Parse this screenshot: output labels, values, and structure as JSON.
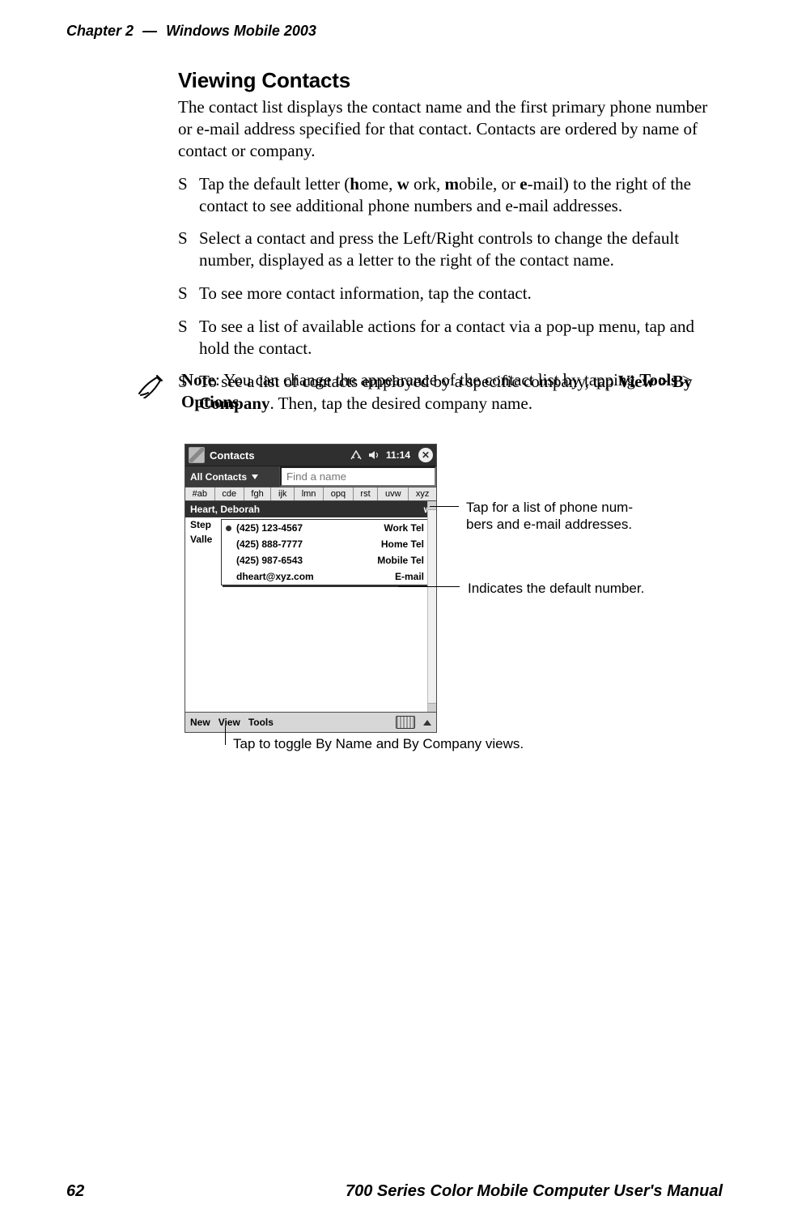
{
  "header": {
    "chapter": "Chapter 2",
    "sep": "—",
    "book_part": "Windows Mobile 2003"
  },
  "footer": {
    "page": "62",
    "manual": "700 Series Color Mobile Computer User's Manual"
  },
  "section": {
    "title": "Viewing Contacts",
    "intro": "The contact list displays the contact name and the first primary phone number or e-mail address specified for that contact. Contacts are ordered by name of contact or company."
  },
  "bullets": {
    "b1_pre": "Tap the default letter (",
    "b1_h": "h",
    "b1_home_rest": "ome, ",
    "b1_w": "w",
    "b1_work_rest": " ork, ",
    "b1_m": "m",
    "b1_mobile_rest": "obile, or ",
    "b1_e": "e",
    "b1_email_rest": "-mail) to the right of the contact to see additional phone numbers and e-mail addresses.",
    "b2": "Select a contact and press the Left/Right controls to change the default number, displayed as a letter to the right of the contact name.",
    "b3": "To see more contact information, tap the contact.",
    "b4": "To see a list of available actions for a contact via a pop-up menu, tap and hold the contact.",
    "b5_pre": "To see a list of contacts employed by a specific company, tap ",
    "b5_view": "View",
    "b5_gt": " > ",
    "b5_bycompany": "By Company",
    "b5_post": ". Then, tap the desired company name."
  },
  "note": {
    "label": "Note",
    "pre": ": You can change the appearance of the contact list by tapping ",
    "tools": "Tools",
    "gt": " > ",
    "options": "Options",
    "post": "."
  },
  "shot": {
    "title": "Contacts",
    "clock": "11:14",
    "filter": "All Contacts",
    "find": "Find a name",
    "alpha": [
      "#ab",
      "cde",
      "fgh",
      "ijk",
      "lmn",
      "opq",
      "rst",
      "uvw",
      "xyz"
    ],
    "sel_name": "Heart, Deborah",
    "sel_def": "w",
    "stub1": "Step",
    "stub2": "Valle",
    "popup": [
      {
        "v": "(425) 123-4567",
        "t": "Work Tel"
      },
      {
        "v": "(425) 888-7777",
        "t": "Home Tel"
      },
      {
        "v": "(425) 987-6543",
        "t": "Mobile Tel"
      },
      {
        "v": "dheart@xyz.com",
        "t": "E-mail"
      }
    ],
    "menu": [
      "New",
      "View",
      "Tools"
    ]
  },
  "callouts": {
    "c1a": "Tap for a list of phone num-",
    "c1b": "bers and e-mail addresses.",
    "c2": "Indicates the default number.",
    "c3": "Tap to toggle By Name and By Company views."
  }
}
